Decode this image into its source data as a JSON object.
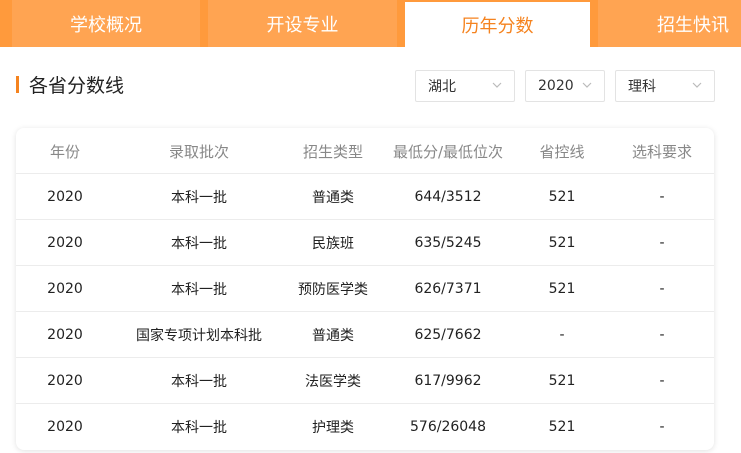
{
  "tabs": [
    {
      "label": "学校概况",
      "active": false
    },
    {
      "label": "开设专业",
      "active": false
    },
    {
      "label": "历年分数",
      "active": true
    },
    {
      "label": "招生快讯",
      "active": false
    }
  ],
  "section": {
    "title": "各省分数线"
  },
  "filters": {
    "province": "湖北",
    "year": "2020",
    "subject": "理科"
  },
  "table": {
    "headers": [
      "年份",
      "录取批次",
      "招生类型",
      "最低分/最低位次",
      "省控线",
      "选科要求"
    ],
    "rows": [
      [
        "2020",
        "本科一批",
        "普通类",
        "644/3512",
        "521",
        "-"
      ],
      [
        "2020",
        "本科一批",
        "民族班",
        "635/5245",
        "521",
        "-"
      ],
      [
        "2020",
        "本科一批",
        "预防医学类",
        "626/7371",
        "521",
        "-"
      ],
      [
        "2020",
        "国家专项计划本科批",
        "普通类",
        "625/7662",
        "-",
        "-"
      ],
      [
        "2020",
        "本科一批",
        "法医学类",
        "617/9962",
        "521",
        "-"
      ],
      [
        "2020",
        "本科一批",
        "护理类",
        "576/26048",
        "521",
        "-"
      ]
    ]
  },
  "colors": {
    "accent": "#f5831f",
    "tab_bg": "#ffa452",
    "tab_strip": "#ff9a3c"
  },
  "icons": {
    "dropdown": "chevron-down-icon"
  }
}
